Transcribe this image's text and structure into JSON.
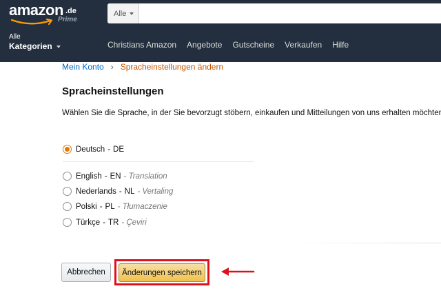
{
  "header": {
    "logo": {
      "word": "amazon",
      "tld": ".de",
      "sub": "Prime"
    },
    "search_category": "Alle",
    "search_value": "",
    "all_categories": {
      "line1": "Alle",
      "line2": "Kategorien"
    },
    "nav": [
      "Christians Amazon",
      "Angebote",
      "Gutscheine",
      "Verkaufen",
      "Hilfe"
    ]
  },
  "breadcrumb": {
    "root": "Mein Konto",
    "separator": "›",
    "current": "Spracheinstellungen ändern"
  },
  "page": {
    "title": "Spracheinstellungen",
    "description": "Wählen Sie die Sprache, in der Sie bevorzugt stöbern, einkaufen und Mitteilungen von uns erhalten möchten."
  },
  "languages": [
    {
      "name": "Deutsch",
      "code": "DE",
      "translation": "",
      "selected": true
    },
    {
      "name": "English",
      "code": "EN",
      "translation": "Translation",
      "selected": false
    },
    {
      "name": "Nederlands",
      "code": "NL",
      "translation": "Vertaling",
      "selected": false
    },
    {
      "name": "Polski",
      "code": "PL",
      "translation": "Tłumaczenie",
      "selected": false
    },
    {
      "name": "Türkçe",
      "code": "TR",
      "translation": "Çeviri",
      "selected": false
    }
  ],
  "buttons": {
    "cancel": "Abbrechen",
    "save": "Änderungen speichern"
  },
  "colors": {
    "header_bg": "#232f3e",
    "accent_orange": "#e77600",
    "link_blue": "#0066c0",
    "highlight_red": "#e0101a"
  }
}
